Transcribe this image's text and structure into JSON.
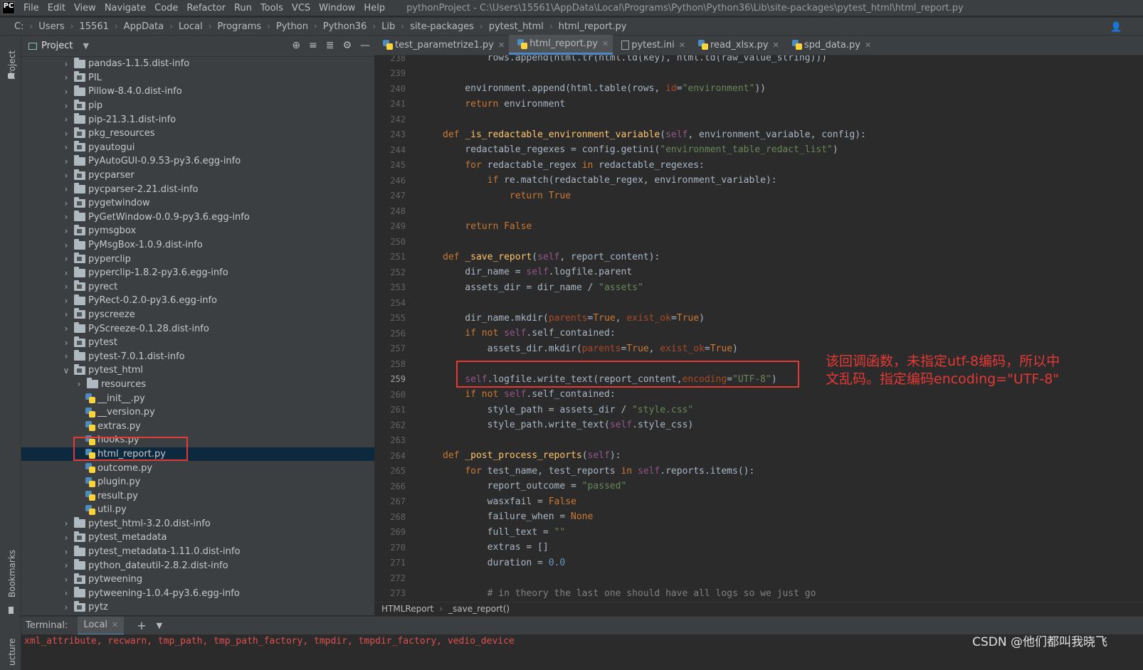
{
  "menu": {
    "logo": "PC",
    "items": [
      "File",
      "Edit",
      "View",
      "Navigate",
      "Code",
      "Refactor",
      "Run",
      "Tools",
      "VCS",
      "Window",
      "Help"
    ],
    "window_title": "pythonProject - C:\\Users\\15561\\AppData\\Local\\Programs\\Python\\Python36\\Lib\\site-packages\\pytest_html\\html_report.py"
  },
  "breadcrumb": [
    "C:",
    "Users",
    "15561",
    "AppData",
    "Local",
    "Programs",
    "Python",
    "Python36",
    "Lib",
    "site-packages",
    "pytest_html",
    "html_report.py"
  ],
  "side_labels": {
    "project": "Project",
    "bookmarks": "Bookmarks",
    "structure": "ucture"
  },
  "project_panel": {
    "title": "Project",
    "tree": [
      {
        "label": "pandas-1.1.5.dist-info",
        "type": "folder",
        "depth": 0
      },
      {
        "label": "PIL",
        "type": "pkg",
        "depth": 0
      },
      {
        "label": "Pillow-8.4.0.dist-info",
        "type": "folder",
        "depth": 0
      },
      {
        "label": "pip",
        "type": "pkg",
        "depth": 0
      },
      {
        "label": "pip-21.3.1.dist-info",
        "type": "folder",
        "depth": 0
      },
      {
        "label": "pkg_resources",
        "type": "pkg",
        "depth": 0
      },
      {
        "label": "pyautogui",
        "type": "pkg",
        "depth": 0
      },
      {
        "label": "PyAutoGUI-0.9.53-py3.6.egg-info",
        "type": "folder",
        "depth": 0
      },
      {
        "label": "pycparser",
        "type": "pkg",
        "depth": 0
      },
      {
        "label": "pycparser-2.21.dist-info",
        "type": "folder",
        "depth": 0
      },
      {
        "label": "pygetwindow",
        "type": "pkg",
        "depth": 0
      },
      {
        "label": "PyGetWindow-0.0.9-py3.6.egg-info",
        "type": "folder",
        "depth": 0
      },
      {
        "label": "pymsgbox",
        "type": "pkg",
        "depth": 0
      },
      {
        "label": "PyMsgBox-1.0.9.dist-info",
        "type": "folder",
        "depth": 0
      },
      {
        "label": "pyperclip",
        "type": "pkg",
        "depth": 0
      },
      {
        "label": "pyperclip-1.8.2-py3.6.egg-info",
        "type": "folder",
        "depth": 0
      },
      {
        "label": "pyrect",
        "type": "pkg",
        "depth": 0
      },
      {
        "label": "PyRect-0.2.0-py3.6.egg-info",
        "type": "folder",
        "depth": 0
      },
      {
        "label": "pyscreeze",
        "type": "pkg",
        "depth": 0
      },
      {
        "label": "PyScreeze-0.1.28.dist-info",
        "type": "folder",
        "depth": 0
      },
      {
        "label": "pytest",
        "type": "pkg",
        "depth": 0
      },
      {
        "label": "pytest-7.0.1.dist-info",
        "type": "folder",
        "depth": 0
      },
      {
        "label": "pytest_html",
        "type": "pkg",
        "depth": 0,
        "open": true
      },
      {
        "label": "resources",
        "type": "folder",
        "depth": 1
      },
      {
        "label": "__init__.py",
        "type": "py",
        "depth": 1
      },
      {
        "label": "__version.py",
        "type": "py",
        "depth": 1
      },
      {
        "label": "extras.py",
        "type": "py",
        "depth": 1
      },
      {
        "label": "hooks.py",
        "type": "py",
        "depth": 1
      },
      {
        "label": "html_report.py",
        "type": "py",
        "depth": 1,
        "selected": true
      },
      {
        "label": "outcome.py",
        "type": "py",
        "depth": 1
      },
      {
        "label": "plugin.py",
        "type": "py",
        "depth": 1
      },
      {
        "label": "result.py",
        "type": "py",
        "depth": 1
      },
      {
        "label": "util.py",
        "type": "py",
        "depth": 1
      },
      {
        "label": "pytest_html-3.2.0.dist-info",
        "type": "folder",
        "depth": 0
      },
      {
        "label": "pytest_metadata",
        "type": "pkg",
        "depth": 0
      },
      {
        "label": "pytest_metadata-1.11.0.dist-info",
        "type": "folder",
        "depth": 0
      },
      {
        "label": "python_dateutil-2.8.2.dist-info",
        "type": "folder",
        "depth": 0
      },
      {
        "label": "pytweening",
        "type": "pkg",
        "depth": 0
      },
      {
        "label": "pytweening-1.0.4-py3.6.egg-info",
        "type": "folder",
        "depth": 0
      },
      {
        "label": "pytz",
        "type": "pkg",
        "depth": 0
      }
    ]
  },
  "editor": {
    "tabs": [
      {
        "label": "test_parametrize1.py",
        "active": false
      },
      {
        "label": "html_report.py",
        "active": true
      },
      {
        "label": "pytest.ini",
        "active": false
      },
      {
        "label": "read_xlsx.py",
        "active": false
      },
      {
        "label": "spd_data.py",
        "active": false
      }
    ],
    "lines": [
      {
        "n": "238",
        "html": "        rows.append(html.tr(html.td(key), html.td(raw_value_string)))"
      },
      {
        "n": "239",
        "html": ""
      },
      {
        "n": "240",
        "html": "    environment.append(html.table(rows, <span class='pa'>id</span>=<span class='st'>\"environment\"</span>))"
      },
      {
        "n": "241",
        "html": "    <span class='kw'>return</span> environment"
      },
      {
        "n": "242",
        "html": ""
      },
      {
        "n": "243",
        "html": "<span class='kw'>def</span> <span class='fn'>_is_redactable_environment_variable</span>(<span class='se'>self</span>, environment_variable, config):"
      },
      {
        "n": "244",
        "html": "    redactable_regexes = config.getini(<span class='st'>\"environment_table_redact_list\"</span>)"
      },
      {
        "n": "245",
        "html": "    <span class='kw'>for</span> redactable_regex <span class='kw'>in</span> redactable_regexes:"
      },
      {
        "n": "246",
        "html": "        <span class='kw'>if</span> re.match(redactable_regex, environment_variable):"
      },
      {
        "n": "247",
        "html": "            <span class='kw'>return True</span>"
      },
      {
        "n": "248",
        "html": ""
      },
      {
        "n": "249",
        "html": "    <span class='kw'>return False</span>"
      },
      {
        "n": "250",
        "html": ""
      },
      {
        "n": "251",
        "html": "<span class='kw'>def</span> <span class='fn'>_save_report</span>(<span class='se'>self</span>, report_content):"
      },
      {
        "n": "252",
        "html": "    dir_name = <span class='se'>self</span>.logfile.parent"
      },
      {
        "n": "253",
        "html": "    assets_dir = dir_name / <span class='st'>\"assets\"</span>"
      },
      {
        "n": "254",
        "html": ""
      },
      {
        "n": "255",
        "html": "    dir_name.mkdir(<span class='pa'>parents</span>=<span class='kw'>True</span>, <span class='pa'>exist_ok</span>=<span class='kw'>True</span>)"
      },
      {
        "n": "256",
        "html": "    <span class='kw'>if not</span> <span class='se'>self</span>.self_contained:"
      },
      {
        "n": "257",
        "html": "        assets_dir.mkdir(<span class='pa'>parents</span>=<span class='kw'>True</span>, <span class='pa'>exist_ok</span>=<span class='kw'>True</span>)"
      },
      {
        "n": "258",
        "html": ""
      },
      {
        "n": "259",
        "html": "    <span class='se'>self</span>.logfile.write_text(report_content,<span class='pa'>encoding</span>=<span class='st'>\"UTF-8\"</span>)",
        "current": true
      },
      {
        "n": "260",
        "html": "    <span class='kw'>if not</span> <span class='se'>self</span>.self_contained:"
      },
      {
        "n": "261",
        "html": "        style_path = assets_dir / <span class='st'>\"style.css\"</span>"
      },
      {
        "n": "262",
        "html": "        style_path.write_text(<span class='se'>self</span>.style_css)"
      },
      {
        "n": "263",
        "html": ""
      },
      {
        "n": "264",
        "html": "<span class='kw'>def</span> <span class='fn'>_post_process_reports</span>(<span class='se'>self</span>):"
      },
      {
        "n": "265",
        "html": "    <span class='kw'>for</span> test_name, test_reports <span class='kw'>in</span> <span class='se'>self</span>.reports.items():"
      },
      {
        "n": "266",
        "html": "        report_outcome = <span class='st'>\"passed\"</span>"
      },
      {
        "n": "267",
        "html": "        wasxfail = <span class='kw'>False</span>"
      },
      {
        "n": "268",
        "html": "        failure_when = <span class='kw'>None</span>"
      },
      {
        "n": "269",
        "html": "        full_text = <span class='st'>\"\"</span>"
      },
      {
        "n": "270",
        "html": "        extras = []"
      },
      {
        "n": "271",
        "html": "        duration = <span class='nu'>0.0</span>"
      },
      {
        "n": "272",
        "html": ""
      },
      {
        "n": "273",
        "html": "        <span class='cm'># in theory the last one should have all logs so we just go</span>"
      }
    ],
    "annotation_line1": "该回调函数，未指定utf-8编码，所以中",
    "annotation_line2": "文乱码。指定编码encoding=\"UTF-8\"",
    "breadcrumb_class": "HTMLReport",
    "breadcrumb_func": "_save_report()"
  },
  "terminal": {
    "label": "Terminal:",
    "tab": "Local",
    "output": "xml_attribute, recwarn, tmp_path, tmp_path_factory, tmpdir, tmpdir_factory, vedio_device"
  },
  "watermark": "CSDN @他们都叫我晓飞"
}
